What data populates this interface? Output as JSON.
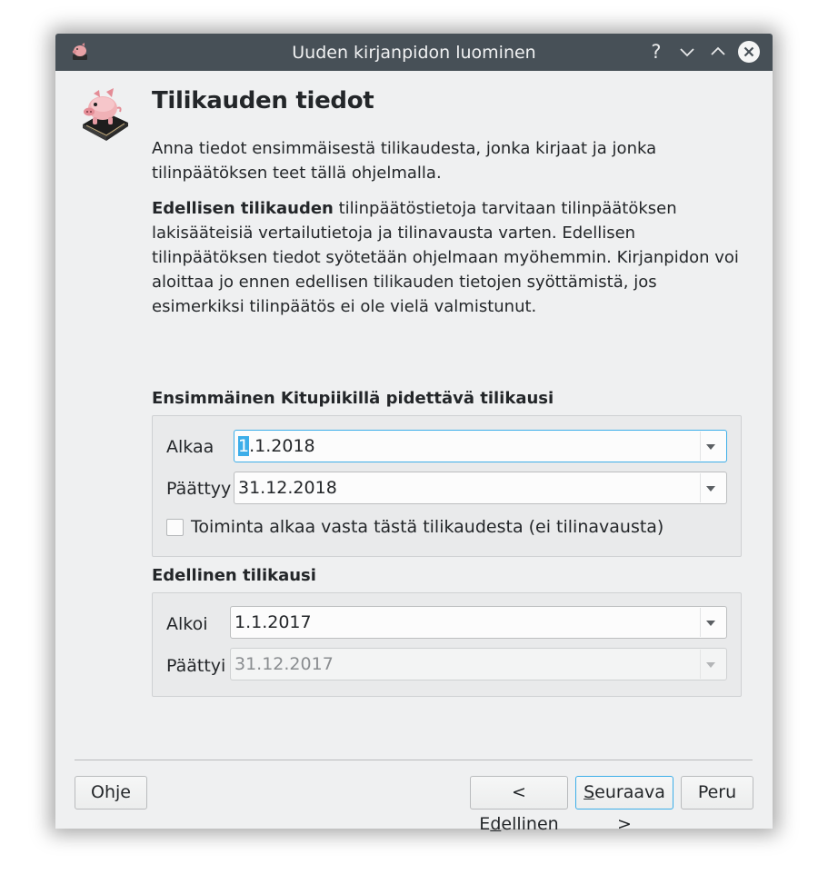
{
  "window": {
    "title": "Uuden kirjanpidon luominen",
    "help_glyph": "?"
  },
  "header": {
    "title": "Tilikauden tiedot",
    "para1": "Anna tiedot ensimmäisestä tilikaudesta, jonka kirjaat ja jonka tilinpäätöksen teet tällä ohjelmalla.",
    "para2_bold": "Edellisen tilikauden",
    "para2_rest": " tilinpäätöstietoja tarvitaan tilinpäätöksen lakisääteisiä vertailutietoja ja tilinavausta varten. Edellisen tilinpäätöksen tiedot syötetään ohjelmaan myöhemmin. Kirjanpidon voi aloittaa jo ennen edellisen tilikauden tietojen syöttämistä, jos esimerkiksi tilinpäätös ei ole vielä valmistunut."
  },
  "first_period": {
    "title": "Ensimmäinen Kitupiikillä pidettävä tilikausi",
    "start_label": "Alkaa",
    "start_value_first_char": "1",
    "start_value_rest": ".1.2018",
    "end_label": "Päättyy",
    "end_value": "31.12.2018",
    "checkbox_label": "Toiminta alkaa vasta tästä tilikaudesta (ei tilinavausta)",
    "checkbox_checked": false
  },
  "previous_period": {
    "title": "Edellinen tilikausi",
    "start_label": "Alkoi",
    "start_value": "1.1.2017",
    "end_label": "Päättyi",
    "end_value": "31.12.2017"
  },
  "buttons": {
    "help_pre": "Oh",
    "help_mn": "j",
    "help_post": "e",
    "back_pre": "< E",
    "back_mn": "d",
    "back_post": "ellinen",
    "next_pre": "",
    "next_mn": "S",
    "next_post": "euraava >",
    "cancel": "Peru"
  },
  "icons": {
    "app": "piggy-bank-book-icon",
    "help": "help-icon",
    "minimize": "chevron-down-icon",
    "maximize": "chevron-up-icon",
    "close": "close-icon"
  },
  "colors": {
    "accent": "#3daee9",
    "titlebar": "#475057",
    "background": "#eff0f1"
  }
}
